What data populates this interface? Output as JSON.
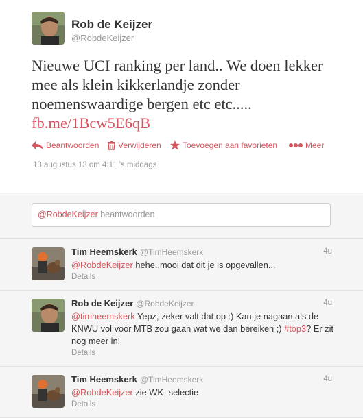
{
  "main_tweet": {
    "name": "Rob de Keijzer",
    "handle": "@RobdeKeijzer",
    "text": "Nieuwe UCI ranking per land.. We doen lekker mee als klein  kikkerlandje zonder noemenswaardige bergen etc etc..... ",
    "link": "fb.me/1Bcw5E6qB",
    "timestamp": "13 augustus 13 om 4:11 's middags",
    "actions": {
      "reply": "Beantwoorden",
      "delete": "Verwijderen",
      "favorite": "Toevoegen aan favorieten",
      "more": "Meer"
    }
  },
  "reply_box": {
    "mention": "@RobdeKeijzer",
    "placeholder": " beantwoorden"
  },
  "conversation": [
    {
      "name": "Tim Heemskerk",
      "handle": "@TimHeemskerk",
      "time": "4u",
      "mention": "@RobdeKeijzer",
      "text": " hehe..mooi dat dit je is opgevallen...",
      "details": "Details"
    },
    {
      "name": "Rob de Keijzer",
      "handle": "@RobdeKeijzer",
      "time": "4u",
      "mention": "@timheemskerk",
      "text_a": " Yepz, zeker valt dat op :)  Kan je nagaan als de KNWU vol voor MTB zou gaan wat we dan bereiken ;) ",
      "hashtag": "#top3",
      "text_b": "? Er zit nog meer in!",
      "details": "Details"
    },
    {
      "name": "Tim Heemskerk",
      "handle": "@TimHeemskerk",
      "time": "4u",
      "mention": "@RobdeKeijzer",
      "text": " zie WK- selectie",
      "details": "Details"
    }
  ],
  "colors": {
    "link": "#d6555e",
    "muted": "#999999",
    "background": "#f5f5f5"
  }
}
